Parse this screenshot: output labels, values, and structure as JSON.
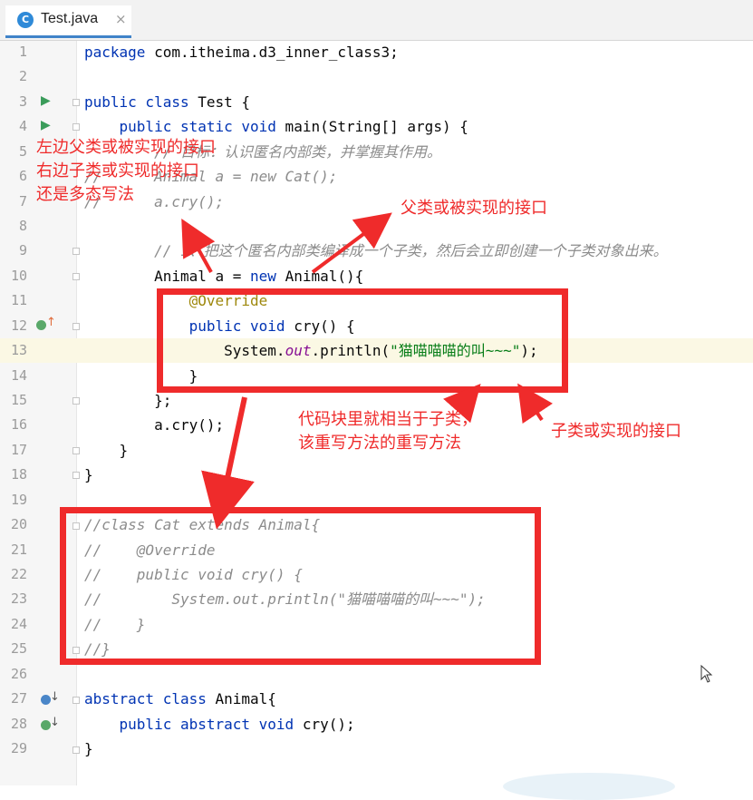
{
  "tab": {
    "title": "Test.java",
    "close": "×",
    "icon": "C"
  },
  "lines": [
    {
      "n": "1",
      "html": "<span class='kw'>package</span> com.itheima.d3_inner_class3;"
    },
    {
      "n": "2",
      "html": ""
    },
    {
      "n": "3",
      "html": "<span class='kw'>public class</span> Test {"
    },
    {
      "n": "4",
      "html": "    <span class='kw'>public static void</span> main(String[] args) {"
    },
    {
      "n": "5",
      "html": "<span class='cmt'>        // 目标：认识匿名内部类，并掌握其作用。</span>"
    },
    {
      "n": "6",
      "html": "<span class='cmt'>//      Animal a = new Cat();</span>"
    },
    {
      "n": "7",
      "html": "<span class='cmt'>//      a.cry();</span>"
    },
    {
      "n": "8",
      "html": ""
    },
    {
      "n": "9",
      "html": "<span class='cmt'>        // 1、把这个匿名内部类编译成一个子类，然后会立即创建一个子类对象出来。</span>"
    },
    {
      "n": "10",
      "html": "        Animal a = <span class='kw'>new</span> Animal(){"
    },
    {
      "n": "11",
      "html": "            <span class='ann'>@Override</span>"
    },
    {
      "n": "12",
      "html": "            <span class='kw'>public void</span> cry() {"
    },
    {
      "n": "13",
      "html": "                System.<span class='static'>out</span>.println(<span class='str'>\"猫喵喵喵的叫~~~\"</span>);"
    },
    {
      "n": "14",
      "html": "            }"
    },
    {
      "n": "15",
      "html": "        };"
    },
    {
      "n": "16",
      "html": "        a.cry();"
    },
    {
      "n": "17",
      "html": "    }"
    },
    {
      "n": "18",
      "html": "}"
    },
    {
      "n": "19",
      "html": ""
    },
    {
      "n": "20",
      "html": "<span class='cmt'>//class Cat extends Animal{</span>"
    },
    {
      "n": "21",
      "html": "<span class='cmt'>//    @Override</span>"
    },
    {
      "n": "22",
      "html": "<span class='cmt'>//    public void cry() {</span>"
    },
    {
      "n": "23",
      "html": "<span class='cmt'>//        System.out.println(\"猫喵喵喵的叫~~~\");</span>"
    },
    {
      "n": "24",
      "html": "<span class='cmt'>//    }</span>"
    },
    {
      "n": "25",
      "html": "<span class='cmt'>//}</span>"
    },
    {
      "n": "26",
      "html": ""
    },
    {
      "n": "27",
      "html": "<span class='kw'>abstract class</span> Animal{"
    },
    {
      "n": "28",
      "html": "    <span class='kw'>public abstract void</span> cry();"
    },
    {
      "n": "29",
      "html": "}"
    }
  ],
  "annotations": {
    "left_note": [
      "左边父类或被实现的接口",
      "右边子类或实现的接口",
      "还是多态写法"
    ],
    "parent_note": "父类或被实现的接口",
    "code_block_note": [
      "代码块里就相当于子类，",
      "该重写方法的重写方法"
    ],
    "child_note": "子类或实现的接口"
  },
  "colors": {
    "accent_red": "#ef2b2b",
    "keyword": "#0033b3",
    "string": "#067d17",
    "comment": "#8c8c8c"
  }
}
